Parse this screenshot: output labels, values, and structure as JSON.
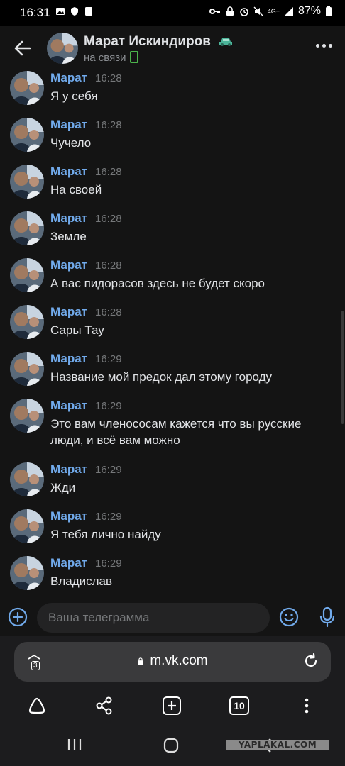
{
  "status_bar": {
    "time": "16:31",
    "network": "4G+",
    "battery": "87%"
  },
  "header": {
    "contact_name": "Марат Искиндиров",
    "status": "на связи"
  },
  "messages": [
    {
      "author": "Марат",
      "time": "16:28",
      "text": "Я у себя"
    },
    {
      "author": "Марат",
      "time": "16:28",
      "text": "Чучело"
    },
    {
      "author": "Марат",
      "time": "16:28",
      "text": "На своей"
    },
    {
      "author": "Марат",
      "time": "16:28",
      "text": "Земле"
    },
    {
      "author": "Марат",
      "time": "16:28",
      "text": "А вас пидорасов здесь не будет скоро"
    },
    {
      "author": "Марат",
      "time": "16:28",
      "text": "Сары Тау"
    },
    {
      "author": "Марат",
      "time": "16:29",
      "text": "Название мой предок дал этому городу"
    },
    {
      "author": "Марат",
      "time": "16:29",
      "text": "Это вам членососам кажется что вы русские люди, и всё вам можно"
    },
    {
      "author": "Марат",
      "time": "16:29",
      "text": "Жди"
    },
    {
      "author": "Марат",
      "time": "16:29",
      "text": "Я тебя лично найду"
    },
    {
      "author": "Марат",
      "time": "16:29",
      "text": "Владислав"
    }
  ],
  "composer": {
    "placeholder": "Ваша телеграмма"
  },
  "browser": {
    "url": "m.vk.com",
    "tab_switcher_count": "3",
    "open_tabs_count": "10"
  },
  "watermark": "YAPLAKAL.COM",
  "colors": {
    "background": "#141414",
    "author": "#71aaeb",
    "online": "#4bb34b",
    "accent": "#71aaeb"
  }
}
